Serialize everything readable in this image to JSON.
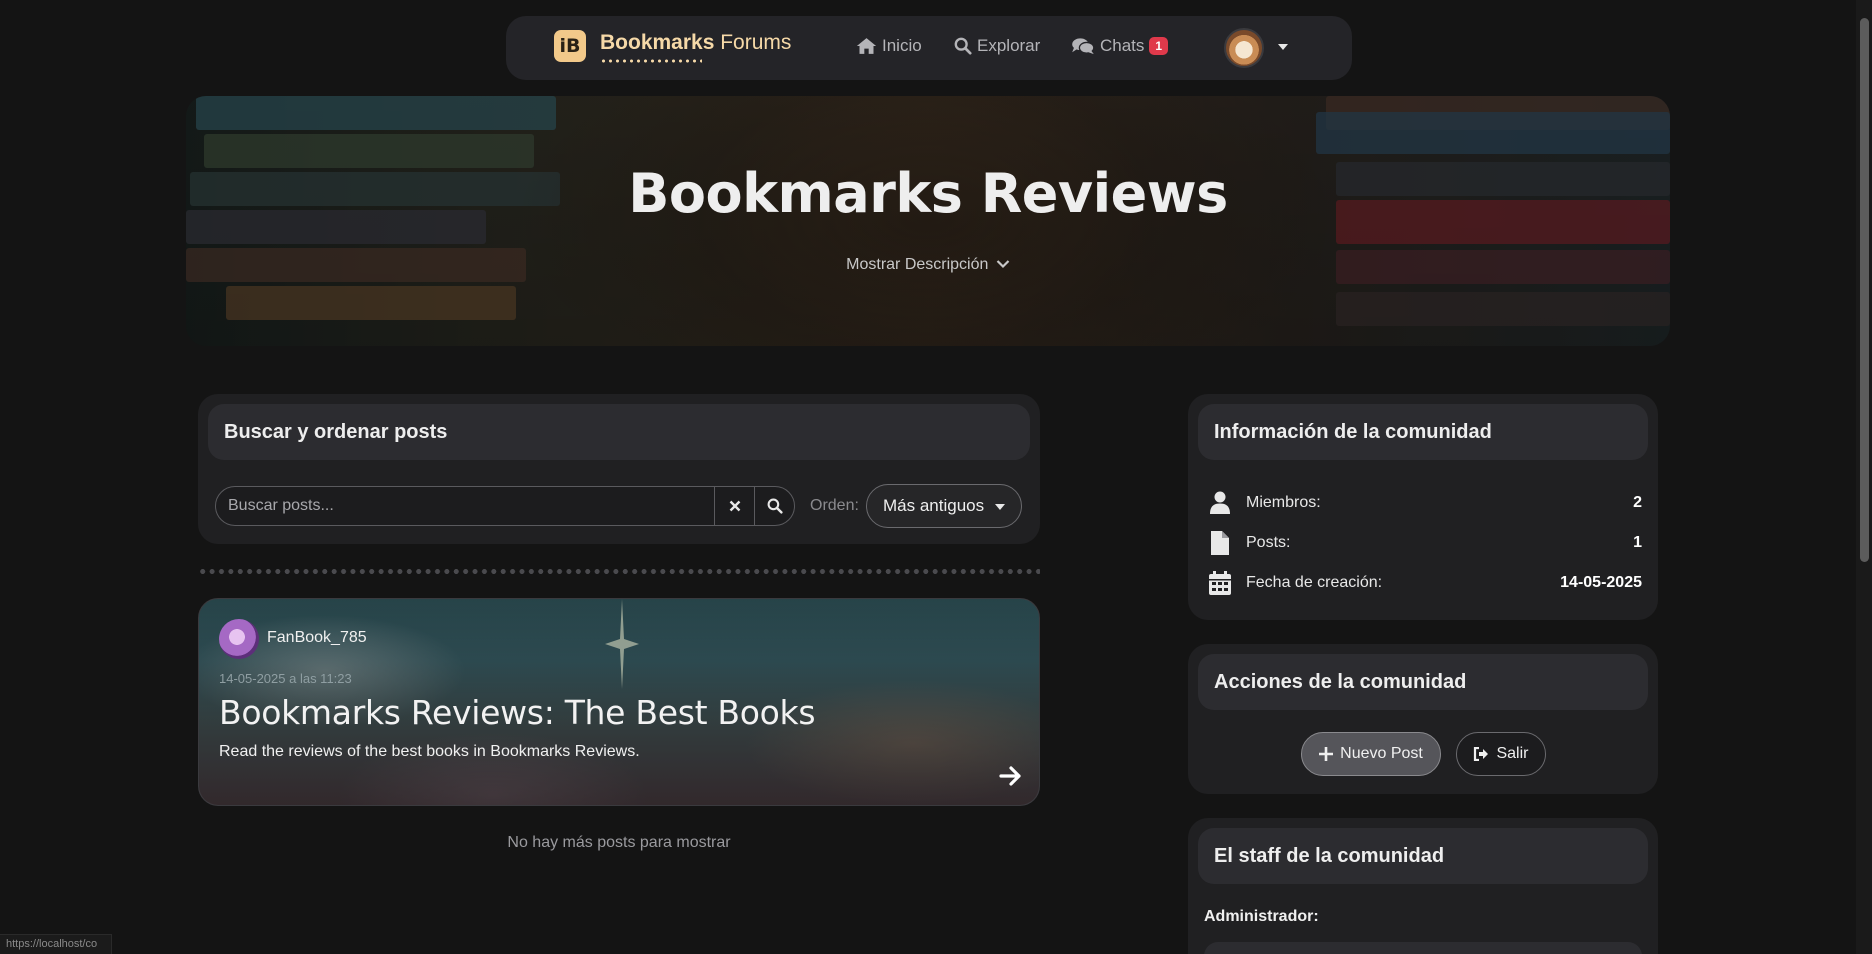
{
  "navbar": {
    "brand_bold": "Bookmarks",
    "brand_light": " Forums",
    "brand_logo": "iB",
    "links": {
      "inicio": "Inicio",
      "explorar": "Explorar",
      "chats": "Chats"
    },
    "chats_badge": "1"
  },
  "hero": {
    "title": "Bookmarks Reviews",
    "toggle_description": "Mostrar Descripción"
  },
  "search": {
    "heading": "Buscar y ordenar posts",
    "placeholder": "Buscar posts...",
    "order_label": "Orden:",
    "order_value": "Más antiguos"
  },
  "posts": [
    {
      "author": "FanBook_785",
      "date": "14-05-2025 a las 11:23",
      "title": "Bookmarks Reviews: The Best Books",
      "description": "Read the reviews of the best books in Bookmarks Reviews."
    }
  ],
  "no_more": "No hay más posts para mostrar",
  "community_info": {
    "heading": "Información de la comunidad",
    "rows": [
      {
        "icon": "user-icon",
        "label": "Miembros:",
        "value": "2"
      },
      {
        "icon": "file-icon",
        "label": "Posts:",
        "value": "1"
      },
      {
        "icon": "calendar-icon",
        "label": "Fecha de creación:",
        "value": "14-05-2025"
      }
    ]
  },
  "community_actions": {
    "heading": "Acciones de la comunidad",
    "new_post": "Nuevo Post",
    "leave": "Salir"
  },
  "staff": {
    "heading": "El staff de la comunidad",
    "admin_label": "Administrador:"
  },
  "status_bar_url": "https://localhost/co",
  "colors": {
    "background": "#141414",
    "card": "#202022",
    "accent": "#f6d9a8",
    "badge": "#e0394b"
  }
}
